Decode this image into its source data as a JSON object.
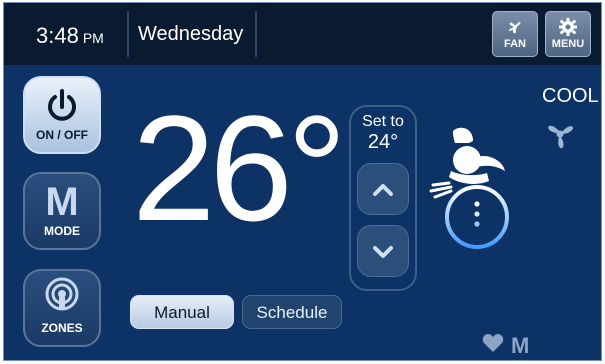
{
  "header": {
    "time": "3:48",
    "ampm": "PM",
    "day": "Wednesday",
    "fan_label": "FAN",
    "menu_label": "MENU"
  },
  "controls": {
    "power_label": "ON / OFF",
    "mode_letter": "M",
    "mode_label": "MODE",
    "zones_label": "ZONES"
  },
  "temperature": {
    "current": "26°",
    "set_to_label": "Set to",
    "setpoint": "24°"
  },
  "schedule_mode": {
    "manual_label": "Manual",
    "schedule_label": "Schedule",
    "selected": "Manual"
  },
  "status": {
    "mode": "COOL",
    "footer_letter": "M"
  },
  "icons": [
    "fan-icon",
    "gear-icon",
    "power-icon",
    "zones-icon",
    "chevron-up-icon",
    "chevron-down-icon",
    "snowman-icon",
    "heart-icon"
  ],
  "colors": {
    "background": "#0d3266",
    "topbar": "#0a1a30",
    "accent_light": "#b7cbe3"
  }
}
